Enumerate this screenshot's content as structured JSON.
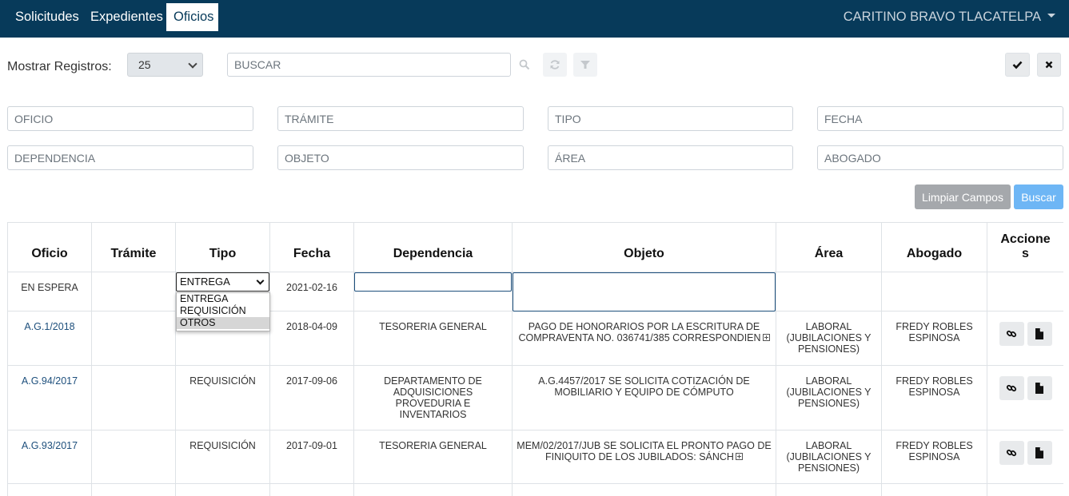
{
  "nav": {
    "items": [
      {
        "label": "Solicitudes"
      },
      {
        "label": "Expedientes"
      },
      {
        "label": "Oficios"
      }
    ],
    "user": "CARITINO BRAVO TLACATELPA"
  },
  "toolbar": {
    "show_label": "Mostrar Registros:",
    "records_selected": "25",
    "search_placeholder": "BUSCAR"
  },
  "filters": {
    "oficio": "OFICIO",
    "tramite": "TRÁMITE",
    "tipo": "TIPO",
    "fecha": "FECHA",
    "dependencia": "DEPENDENCIA",
    "objeto": "OBJETO",
    "area": "ÁREA",
    "abogado": "ABOGADO",
    "clear_label": "Limpiar Campos",
    "search_label": "Buscar"
  },
  "table": {
    "headers": [
      "Oficio",
      "Trámite",
      "Tipo",
      "Fecha",
      "Dependencia",
      "Objeto",
      "Área",
      "Abogado",
      "Accione s"
    ],
    "edit_row": {
      "oficio": "EN ESPERA",
      "tipo_selected": "ENTREGA",
      "tipo_options": [
        "ENTREGA",
        "REQUISICIÓN",
        "OTROS"
      ],
      "fecha": "2021-02-16"
    },
    "rows": [
      {
        "oficio": "A.G.1/2018",
        "tramite": "",
        "tipo": "",
        "fecha": "2018-04-09",
        "dependencia": "TESORERIA GENERAL",
        "objeto": "PAGO DE HONORARIOS POR LA ESCRITURA DE COMPRAVENTA NO. 036741/385 CORRESPONDIEN",
        "area": "LABORAL (JUBILACIONES Y PENSIONES)",
        "abogado": "FREDY ROBLES ESPINOSA"
      },
      {
        "oficio": "A.G.94/2017",
        "tramite": "",
        "tipo": "REQUISICIÓN",
        "fecha": "2017-09-06",
        "dependencia": "DEPARTAMENTO DE ADQUISICIONES PROVEDURIA E INVENTARIOS",
        "objeto": "A.G.4457/2017 SE SOLICITA COTIZACIÓN DE MOBILIARIO Y EQUIPO DE CÓMPUTO",
        "area": "LABORAL (JUBILACIONES Y PENSIONES)",
        "abogado": "FREDY ROBLES ESPINOSA"
      },
      {
        "oficio": "A.G.93/2017",
        "tramite": "",
        "tipo": "REQUISICIÓN",
        "fecha": "2017-09-01",
        "dependencia": "TESORERIA GENERAL",
        "objeto": "MEM/02/2017/JUB SE SOLICITA EL PRONTO PAGO DE FINIQUITO DE LOS JUBILADOS: SÁNCH",
        "area": "LABORAL (JUBILACIONES Y PENSIONES)",
        "abogado": "FREDY ROBLES ESPINOSA"
      }
    ]
  }
}
